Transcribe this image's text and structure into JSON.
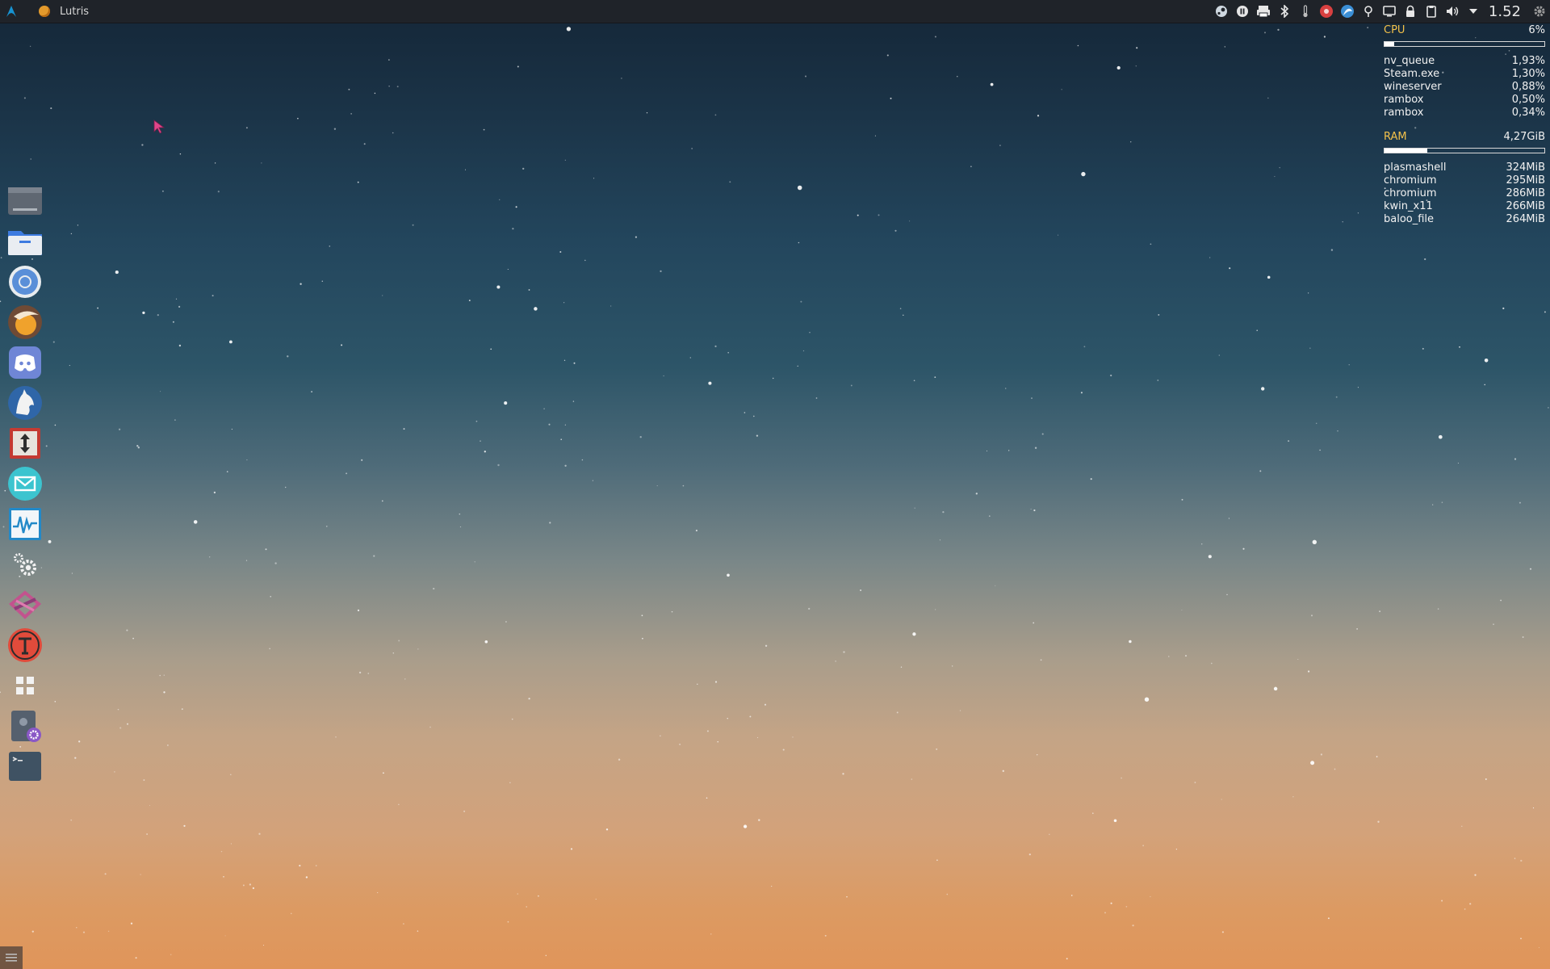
{
  "top_panel": {
    "launcher_icon": "arch-linux-logo-icon",
    "active_task": {
      "icon": "lutris-icon",
      "title": "Lutris"
    },
    "tray_icons": [
      "steam-icon",
      "pause-icon",
      "printer-icon",
      "bluetooth-icon",
      "temperature-icon",
      "record-icon",
      "gnome-icon",
      "pin-icon",
      "display-icon",
      "lock-icon",
      "clipboard-icon",
      "volume-icon",
      "expand-arrow-icon"
    ],
    "clock": "1.52",
    "settings_icon": "gear-icon"
  },
  "dock": {
    "items": [
      {
        "name": "desktop-app"
      },
      {
        "name": "file-manager"
      },
      {
        "name": "chromium"
      },
      {
        "name": "lutris"
      },
      {
        "name": "discord"
      },
      {
        "name": "wolf-app"
      },
      {
        "name": "transfer-app"
      },
      {
        "name": "mail"
      },
      {
        "name": "system-monitor"
      },
      {
        "name": "settings"
      },
      {
        "name": "kde-connect"
      },
      {
        "name": "typora"
      },
      {
        "name": "app-grid"
      },
      {
        "name": "system-settings"
      },
      {
        "name": "terminal"
      }
    ]
  },
  "monitor": {
    "cpu": {
      "label": "CPU",
      "value": "6%",
      "usage_fraction": 0.06,
      "processes": [
        {
          "name": "nv_queue",
          "value": "1,93%"
        },
        {
          "name": "Steam.exe",
          "value": "1,30%"
        },
        {
          "name": "wineserver",
          "value": "0,88%"
        },
        {
          "name": "rambox",
          "value": "0,50%"
        },
        {
          "name": "rambox",
          "value": "0,34%"
        }
      ]
    },
    "ram": {
      "label": "RAM",
      "value": "4,27GiB",
      "usage_fraction": 0.27,
      "processes": [
        {
          "name": "plasmashell",
          "value": "324MiB"
        },
        {
          "name": "chromium",
          "value": "295MiB"
        },
        {
          "name": "chromium",
          "value": "286MiB"
        },
        {
          "name": "kwin_x11",
          "value": "266MiB"
        },
        {
          "name": "baloo_file",
          "value": "264MiB"
        }
      ]
    }
  },
  "colors": {
    "panel": "#1f2329",
    "accent_label": "#f3c14a"
  }
}
